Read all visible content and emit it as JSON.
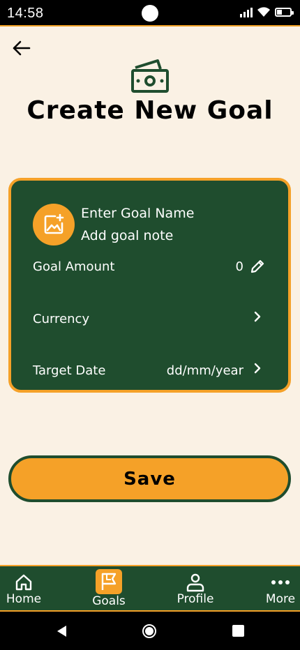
{
  "status_bar": {
    "time": "14:58"
  },
  "header": {
    "title": "Create New Goal"
  },
  "goal_card": {
    "name_placeholder": "Enter Goal Name",
    "note_placeholder": "Add goal note",
    "amount_label": "Goal Amount",
    "amount_value": "0",
    "currency_label": "Currency",
    "date_label": "Target Date",
    "date_value": "dd/mm/year"
  },
  "save_button": {
    "label": "Save"
  },
  "bottom_nav": {
    "items": [
      {
        "label": "Home",
        "icon": "home-icon"
      },
      {
        "label": "Goals",
        "icon": "flag-icon",
        "active": true
      },
      {
        "label": "Profile",
        "icon": "person-icon"
      },
      {
        "label": "More",
        "icon": "dots-icon"
      }
    ]
  },
  "colors": {
    "background": "#faf1e4",
    "primary_green": "#1f4d2e",
    "accent_orange": "#f5a128"
  }
}
